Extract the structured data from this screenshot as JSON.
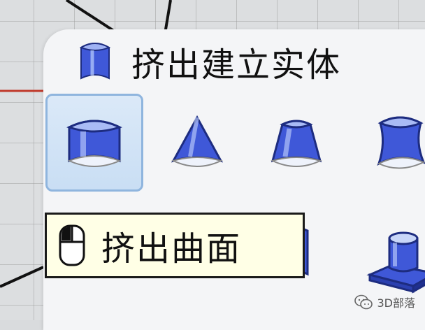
{
  "panel": {
    "title": "挤出建立实体",
    "title_icon": "extrude-surface-icon"
  },
  "tools": [
    {
      "id": "extrude-curve",
      "icon": "extrude-curve-icon",
      "selected": true
    },
    {
      "id": "extrude-to-point",
      "icon": "cone-icon",
      "selected": false
    },
    {
      "id": "extrude-tapered",
      "icon": "tapered-extrude-icon",
      "selected": false
    },
    {
      "id": "extrude-along-curve",
      "icon": "curved-extrude-icon",
      "selected": false
    },
    {
      "id": "extrude-surface",
      "icon": "extrude-surface-tool-icon",
      "selected": false
    },
    {
      "id": "extrude-boss",
      "icon": "boss-icon",
      "selected": false
    }
  ],
  "tooltip": {
    "text": "挤出曲面",
    "icon": "mouse-icon"
  },
  "watermark": {
    "text": "3D部落",
    "icon": "wechat-icon"
  },
  "colors": {
    "icon_blue": "#3f58d8",
    "icon_light": "#d8e4f8",
    "panel_bg": "#f4f5f7",
    "selected_bg": "#d2e4f6",
    "selected_border": "#8fb5de",
    "tooltip_bg": "#ffffe6",
    "axis_red": "#c0392b"
  }
}
